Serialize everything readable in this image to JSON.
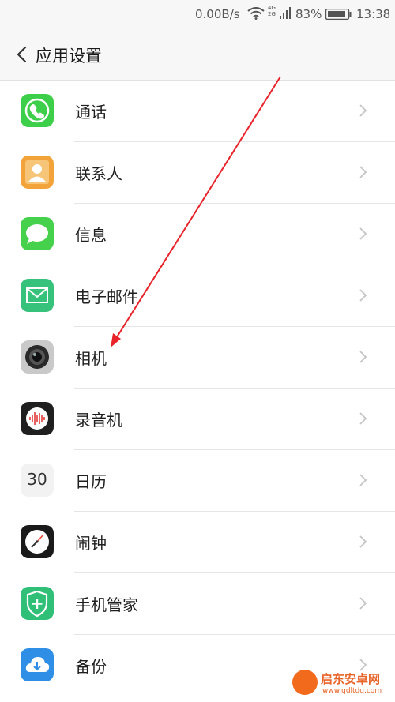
{
  "status": {
    "speed": "0.00B/s",
    "net_top": "4G",
    "net_bottom": "2G",
    "battery": "83%",
    "time": "13:38"
  },
  "header": {
    "title": "应用设置"
  },
  "items": [
    {
      "label": "通话",
      "icon": "phone-icon"
    },
    {
      "label": "联系人",
      "icon": "contacts-icon"
    },
    {
      "label": "信息",
      "icon": "message-icon"
    },
    {
      "label": "电子邮件",
      "icon": "mail-icon"
    },
    {
      "label": "相机",
      "icon": "camera-icon"
    },
    {
      "label": "录音机",
      "icon": "recorder-icon"
    },
    {
      "label": "日历",
      "icon": "calendar-icon",
      "icon_text": "30"
    },
    {
      "label": "闹钟",
      "icon": "clock-icon"
    },
    {
      "label": "手机管家",
      "icon": "shield-icon"
    },
    {
      "label": "备份",
      "icon": "cloud-backup-icon"
    }
  ],
  "watermark": {
    "text": "启东安卓网",
    "url": "www.qdltdq.com"
  }
}
